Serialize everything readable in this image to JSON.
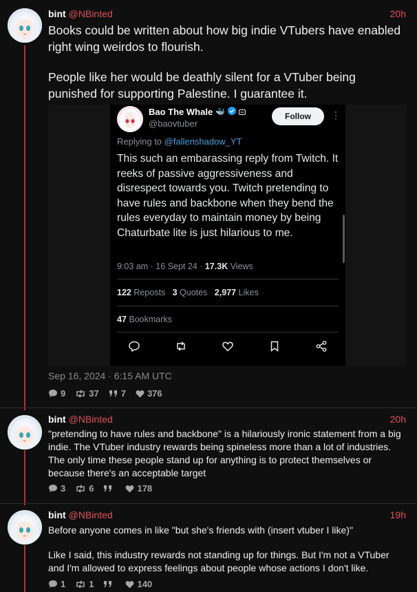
{
  "posts": [
    {
      "name": "bint",
      "handle": "@NBinted",
      "time": "20h",
      "text_p1": "Books could be written about how big indie VTubers have enabled right wing weirdos to flourish.",
      "text_p2": "People like her would be deathly silent for a VTuber being punished for supporting Palestine. I guarantee it.",
      "date": "Sep 16, 2024 · 6:15 AM UTC",
      "stats": {
        "replies": "9",
        "reposts": "37",
        "quotes": "7",
        "likes": "376"
      }
    },
    {
      "name": "bint",
      "handle": "@NBinted",
      "time": "20h",
      "text": "\"pretending to have rules and backbone\" is a hilariously ironic statement from a big indie. The VTuber industry rewards being spineless more than a lot of industries. The only time these people stand up for anything is to protect themselves or because there's an acceptable target",
      "stats": {
        "replies": "3",
        "reposts": "6",
        "quotes": "",
        "likes": "178"
      }
    },
    {
      "name": "bint",
      "handle": "@NBinted",
      "time": "19h",
      "text_p1": "Before anyone comes in like \"but she's friends with (insert vtuber I like)\"",
      "text_p2": "Like I said, this industry rewards not standing up for things. But I'm not a VTuber and I'm allowed to express feelings about people whose actions I don't like.",
      "stats": {
        "replies": "1",
        "reposts": "1",
        "quotes": "",
        "likes": "140"
      }
    }
  ],
  "embedded_tweet": {
    "name": "Bao The Whale",
    "name_emoji": "🐳",
    "handle": "@baovtuber",
    "follow_label": "Follow",
    "more_icon": "⋮",
    "reply_prefix": "Replying to ",
    "reply_to": "@fallenshadow_YT",
    "text": "This such an embarassing reply from Twitch. It reeks of passive aggressiveness and disrespect towards you. Twitch pretending to have rules and backbone when they bend the rules everyday to maintain money by being Chaturbate lite is just hilarious to me.",
    "time": "9:03 am · 16 Sept 24 · ",
    "views_count": "17.3K",
    "views_label": " Views",
    "reposts_count": "122",
    "reposts_label": " Reposts",
    "quotes_count": "3",
    "quotes_label": " Quotes",
    "likes_count": "2,977",
    "likes_label": " Likes",
    "bookmarks_count": "47",
    "bookmarks_label": " Bookmarks"
  },
  "colors": {
    "background": "#0f0f0f",
    "accent": "#e0505a",
    "thread_line": "#b3323a",
    "muted": "#a6a6a6",
    "link": "#4c9ddc"
  },
  "icons": [
    "comment-icon",
    "repost-icon",
    "quote-icon",
    "heart-icon",
    "bookmark-icon",
    "share-icon",
    "verified-icon",
    "more-icon"
  ]
}
